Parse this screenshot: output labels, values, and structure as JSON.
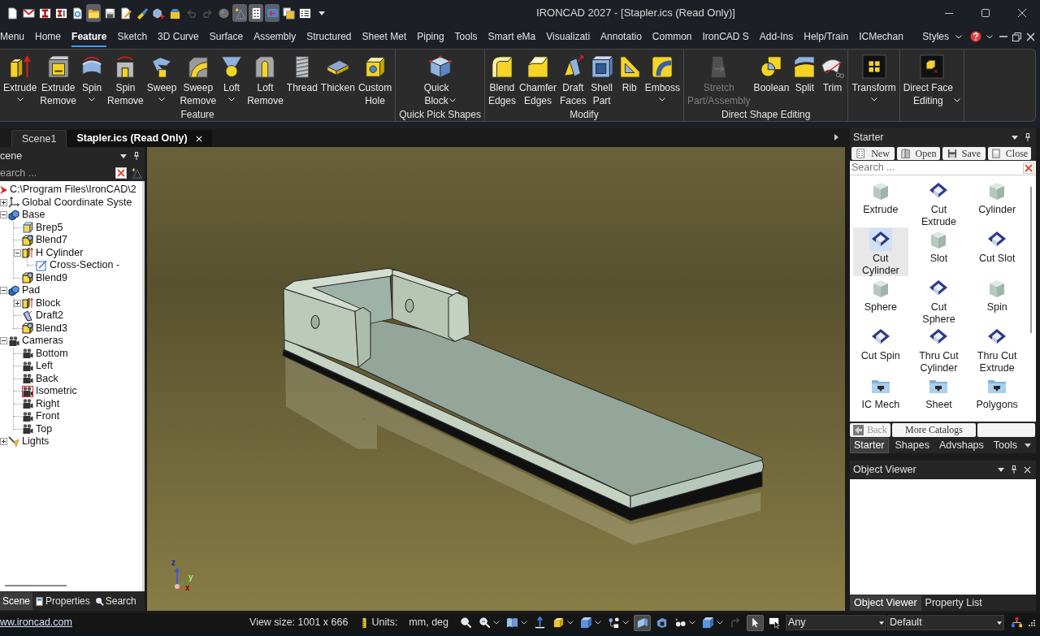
{
  "title_bar": {
    "quick_access": [
      {
        "pressed": false,
        "disabled": false
      },
      {
        "pressed": false,
        "disabled": false
      },
      {
        "pressed": false,
        "disabled": false
      },
      {
        "pressed": false,
        "disabled": false
      },
      {
        "pressed": false,
        "disabled": false
      },
      {
        "pressed": true,
        "disabled": false
      },
      {
        "pressed": false,
        "disabled": false
      },
      {
        "pressed": false,
        "disabled": false
      },
      {
        "pressed": false,
        "disabled": false
      },
      {
        "pressed": false,
        "disabled": false
      },
      {
        "pressed": false,
        "disabled": false
      },
      {
        "pressed": false,
        "disabled": true
      },
      {
        "pressed": false,
        "disabled": true
      },
      {
        "pressed": false,
        "disabled": false
      },
      {
        "pressed": true,
        "disabled": false
      },
      {
        "pressed": true,
        "disabled": false
      },
      {
        "pressed": true,
        "disabled": false
      },
      {
        "pressed": false,
        "disabled": false
      },
      {
        "pressed": false,
        "disabled": false
      }
    ],
    "title": "IRONCAD 2027 - [Stapler.ics (Read Only)]"
  },
  "ribbon_tabs": [
    {
      "label": "Menu",
      "selected": false
    },
    {
      "label": "Home",
      "selected": false
    },
    {
      "label": "Feature",
      "selected": true
    },
    {
      "label": "Sketch",
      "selected": false
    },
    {
      "label": "3D Curve",
      "selected": false
    },
    {
      "label": "Surface",
      "selected": false
    },
    {
      "label": "Assembly",
      "selected": false
    },
    {
      "label": "Structured",
      "selected": false
    },
    {
      "label": "Sheet Met",
      "selected": false
    },
    {
      "label": "Piping",
      "selected": false
    },
    {
      "label": "Tools",
      "selected": false
    },
    {
      "label": "Smart eMa",
      "selected": false
    },
    {
      "label": "Visualizati",
      "selected": false
    },
    {
      "label": "Annotatio",
      "selected": false
    },
    {
      "label": "Common",
      "selected": false
    },
    {
      "label": "IronCAD S",
      "selected": false
    },
    {
      "label": "Add-Ins",
      "selected": false
    },
    {
      "label": "Help/Train",
      "selected": false
    },
    {
      "label": "ICMechan",
      "selected": false
    }
  ],
  "styles_menu": "Styles",
  "ribbon_groups": [
    {
      "title": "Feature",
      "buttons": [
        {
          "label": "Extrude",
          "dropdown": true,
          "disabled": false
        },
        {
          "label": "Extrude\nRemove",
          "dropdown": false,
          "disabled": false
        },
        {
          "label": "Spin",
          "dropdown": true,
          "disabled": false
        },
        {
          "label": "Spin\nRemove",
          "dropdown": false,
          "disabled": false
        },
        {
          "label": "Sweep",
          "dropdown": true,
          "disabled": false
        },
        {
          "label": "Sweep\nRemove",
          "dropdown": false,
          "disabled": false
        },
        {
          "label": "Loft",
          "dropdown": true,
          "disabled": false
        },
        {
          "label": "Loft\nRemove",
          "dropdown": false,
          "disabled": false
        },
        {
          "label": "Thread",
          "dropdown": false,
          "disabled": false
        },
        {
          "label": "Thicken",
          "dropdown": false,
          "disabled": false
        },
        {
          "label": "Custom\nHole",
          "dropdown": false,
          "disabled": false
        }
      ]
    },
    {
      "title": "Quick Pick Shapes",
      "buttons": [
        {
          "label": "Quick\nBlock",
          "dropdown": true,
          "disabled": false
        }
      ]
    },
    {
      "title": "Modify",
      "buttons": [
        {
          "label": "Blend\nEdges",
          "dropdown": false,
          "disabled": false
        },
        {
          "label": "Chamfer\nEdges",
          "dropdown": false,
          "disabled": false
        },
        {
          "label": "Draft\nFaces",
          "dropdown": false,
          "disabled": false
        },
        {
          "label": "Shell\nPart",
          "dropdown": false,
          "disabled": false
        },
        {
          "label": "Rib",
          "dropdown": false,
          "disabled": false
        },
        {
          "label": "Emboss",
          "dropdown": true,
          "disabled": false
        }
      ]
    },
    {
      "title": "Direct Shape Editing",
      "buttons": [
        {
          "label": "Stretch\nPart/Assembly",
          "dropdown": false,
          "disabled": true
        },
        {
          "label": "Boolean",
          "dropdown": false,
          "disabled": false
        },
        {
          "label": "Split",
          "dropdown": false,
          "disabled": false
        },
        {
          "label": "Trim",
          "dropdown": false,
          "disabled": false
        }
      ]
    },
    {
      "buttons": [
        {
          "label": "Transform",
          "dropdown": true,
          "disabled": false
        }
      ]
    },
    {
      "buttons": [
        {
          "label": "Direct Face\nEditing",
          "dropdown": true,
          "disabled": false
        }
      ]
    }
  ],
  "document_tabs": [
    {
      "label": "Scene1",
      "selected": false
    },
    {
      "label": "Stapler.ics (Read Only)",
      "selected": true
    }
  ],
  "scene_panel": {
    "title": "cene",
    "search_placeholder": "earch ...",
    "tree": {
      "label": "C:\\Program Files\\IronCAD\\2",
      "kind": "scene",
      "children": [
        {
          "label": "Global Coordinate Syste",
          "kind": "axes",
          "expanded": false
        },
        {
          "label": "Base",
          "kind": "part",
          "expanded": true,
          "children": [
            {
              "label": "Brep5",
              "kind": "brep"
            },
            {
              "label": "Blend7",
              "kind": "blend"
            },
            {
              "label": "H Cylinder",
              "kind": "extrude",
              "expanded": true,
              "children": [
                {
                  "label": "Cross-Section -",
                  "kind": "sketch"
                }
              ]
            },
            {
              "label": "Blend9",
              "kind": "blend"
            }
          ]
        },
        {
          "label": "Pad",
          "kind": "part",
          "expanded": true,
          "children": [
            {
              "label": "Block",
              "kind": "extrude",
              "expanded": false
            },
            {
              "label": "Draft2",
              "kind": "draft"
            },
            {
              "label": "Blend3",
              "kind": "blend"
            }
          ]
        },
        {
          "label": "Cameras",
          "kind": "camera",
          "expanded": true,
          "children": [
            {
              "label": "Bottom",
              "kind": "camera",
              "active": false
            },
            {
              "label": "Left",
              "kind": "camera",
              "active": false
            },
            {
              "label": "Back",
              "kind": "camera",
              "active": false
            },
            {
              "label": "Isometric",
              "kind": "camera",
              "active": true
            },
            {
              "label": "Right",
              "kind": "camera",
              "active": false
            },
            {
              "label": "Front",
              "kind": "camera",
              "active": false
            },
            {
              "label": "Top",
              "kind": "camera",
              "active": false
            }
          ]
        },
        {
          "label": "Lights",
          "kind": "light",
          "expanded": false
        }
      ]
    },
    "tabs": [
      {
        "label": "Scene",
        "selected": true
      },
      {
        "label": "Properties",
        "selected": false
      },
      {
        "label": "Search",
        "selected": false
      }
    ]
  },
  "viewport": {
    "axis_labels": [
      "z",
      "y",
      "x"
    ]
  },
  "catalog_panel": {
    "title": "Starter",
    "buttons": [
      "New",
      "Open",
      "Save",
      "Close"
    ],
    "search_placeholder": "Search ...",
    "items": [
      {
        "label": "Extrude",
        "kind": "solid",
        "selected": false
      },
      {
        "label": "Cut\nExtrude",
        "kind": "cut",
        "selected": false
      },
      {
        "label": "Cylinder",
        "kind": "solid",
        "selected": false
      },
      {
        "label": "Cut\nCylinder",
        "kind": "cut",
        "selected": true
      },
      {
        "label": "Slot",
        "kind": "solid",
        "selected": false
      },
      {
        "label": "Cut Slot",
        "kind": "cut",
        "selected": false
      },
      {
        "label": "Sphere",
        "kind": "solid",
        "selected": false
      },
      {
        "label": "Cut\nSphere",
        "kind": "cut",
        "selected": false
      },
      {
        "label": "Spin",
        "kind": "solid",
        "selected": false
      },
      {
        "label": "Cut Spin",
        "kind": "cut",
        "selected": false
      },
      {
        "label": "Thru Cut\nCylinder",
        "kind": "cut",
        "selected": false
      },
      {
        "label": "Thru Cut\nExtrude",
        "kind": "cut",
        "selected": false
      },
      {
        "label": "IC Mech",
        "kind": "folder",
        "selected": false
      },
      {
        "label": "Sheet",
        "kind": "folder",
        "selected": false
      },
      {
        "label": "Polygons",
        "kind": "folder",
        "selected": false
      }
    ],
    "nav_buttons": [
      {
        "label": "Back",
        "disabled": true
      },
      {
        "label": "More Catalogs",
        "disabled": false
      }
    ],
    "tabs": [
      {
        "label": "Starter",
        "selected": true
      },
      {
        "label": "Shapes",
        "selected": false
      },
      {
        "label": "Advshaps",
        "selected": false
      },
      {
        "label": "Tools",
        "selected": false
      }
    ]
  },
  "object_viewer": {
    "title": "Object Viewer",
    "tabs": [
      {
        "label": "Object Viewer",
        "selected": true
      },
      {
        "label": "Property List",
        "selected": false
      }
    ]
  },
  "status_bar": {
    "link": "ww.ironcad.com",
    "view_size": "View size: 1001 x 666",
    "units_label": "Units:",
    "units": "mm, deg",
    "tools": [
      {
        "pressed": false,
        "dropdown": false,
        "disabled": false
      },
      {
        "pressed": false,
        "dropdown": true,
        "disabled": false
      },
      {
        "pressed": false,
        "dropdown": true,
        "disabled": false
      },
      {
        "pressed": false,
        "dropdown": false,
        "disabled": false
      },
      {
        "pressed": false,
        "dropdown": true,
        "disabled": false
      },
      {
        "pressed": false,
        "dropdown": true,
        "disabled": false
      },
      {
        "pressed": false,
        "dropdown": true,
        "disabled": false
      },
      {
        "pressed": true,
        "dropdown": false,
        "disabled": false
      },
      {
        "pressed": false,
        "dropdown": false,
        "disabled": false
      },
      {
        "pressed": false,
        "dropdown": true,
        "disabled": false
      },
      {
        "pressed": false,
        "dropdown": true,
        "disabled": false
      },
      {
        "pressed": false,
        "dropdown": false,
        "disabled": true
      },
      {
        "pressed": true,
        "dropdown": false,
        "disabled": false
      },
      {
        "pressed": false,
        "dropdown": false,
        "disabled": false
      }
    ],
    "filter": "Any",
    "style": "Default"
  }
}
